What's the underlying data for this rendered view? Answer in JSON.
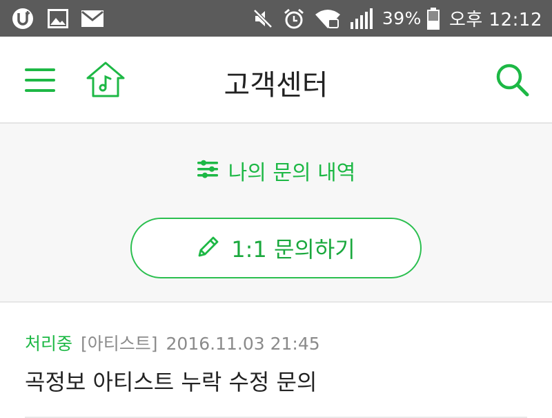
{
  "statusbar": {
    "battery_percent": "39%",
    "time": "오후 12:12",
    "icons": [
      "uplus-icon",
      "image-icon",
      "mail-icon",
      "mute-icon",
      "alarm-icon",
      "wifi-icon",
      "signal-icon",
      "battery-icon"
    ]
  },
  "header": {
    "title": "고객센터",
    "icons": [
      "menu-icon",
      "music-home-icon",
      "search-icon"
    ],
    "accent_color": "#1db845"
  },
  "main": {
    "my_inquiries_label": "나의 문의 내역",
    "inquiry_button_label": "1:1 문의하기"
  },
  "inquiries": [
    {
      "status": "처리중",
      "category": "[아티스트]",
      "datetime": "2016.11.03 21:45",
      "title": "곡정보 아티스트 누락 수정 문의"
    }
  ]
}
